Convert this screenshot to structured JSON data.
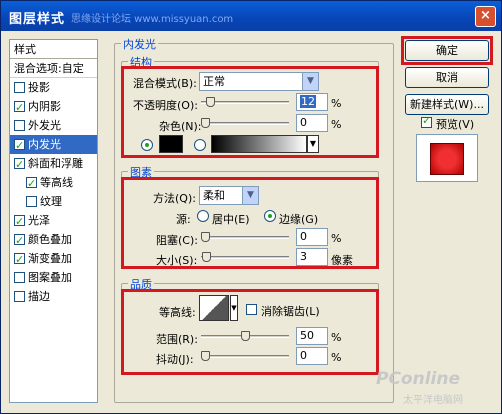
{
  "window": {
    "title": "图层样式",
    "title_watermark": "思缘设计论坛 www.missyuan.com",
    "close": "×"
  },
  "style_list": {
    "header": "样式",
    "blend_options": "混合选项:自定",
    "items": [
      {
        "label": "投影",
        "checked": false
      },
      {
        "label": "内阴影",
        "checked": true
      },
      {
        "label": "外发光",
        "checked": false
      },
      {
        "label": "内发光",
        "checked": true,
        "selected": true
      },
      {
        "label": "斜面和浮雕",
        "checked": true
      },
      {
        "label": "等高线",
        "checked": true,
        "sub": true
      },
      {
        "label": "纹理",
        "checked": false,
        "sub": true
      },
      {
        "label": "光泽",
        "checked": true
      },
      {
        "label": "颜色叠加",
        "checked": true
      },
      {
        "label": "渐变叠加",
        "checked": true
      },
      {
        "label": "图案叠加",
        "checked": false
      },
      {
        "label": "描边",
        "checked": false
      }
    ]
  },
  "panel": {
    "title": "内发光",
    "structure": {
      "title": "结构",
      "blend_mode_label": "混合模式(B):",
      "blend_mode_value": "正常",
      "opacity_label": "不透明度(O):",
      "opacity_value": "12",
      "opacity_unit": "%",
      "noise_label": "杂色(N):",
      "noise_value": "0",
      "noise_unit": "%"
    },
    "elements": {
      "title": "图素",
      "technique_label": "方法(Q):",
      "technique_value": "柔和",
      "source_label": "源:",
      "source_center": "居中(E)",
      "source_edge": "边缘(G)",
      "choke_label": "阻塞(C):",
      "choke_value": "0",
      "choke_unit": "%",
      "size_label": "大小(S):",
      "size_value": "3",
      "size_unit": "像素"
    },
    "quality": {
      "title": "品质",
      "contour_label": "等高线:",
      "antialias_label": "消除锯齿(L)",
      "range_label": "范围(R):",
      "range_value": "50",
      "range_unit": "%",
      "jitter_label": "抖动(J):",
      "jitter_value": "0",
      "jitter_unit": "%"
    }
  },
  "buttons": {
    "ok": "确定",
    "cancel": "取消",
    "new_style": "新建样式(W)...",
    "preview": "预览(V)"
  },
  "watermark": {
    "logo": "PConline",
    "sub": "太平洋电脑网"
  },
  "colors": {
    "highlight_red": "#d4181f",
    "selection_blue": "#316ac5",
    "glow_color": "#000000",
    "preview_red": "#e02020"
  }
}
